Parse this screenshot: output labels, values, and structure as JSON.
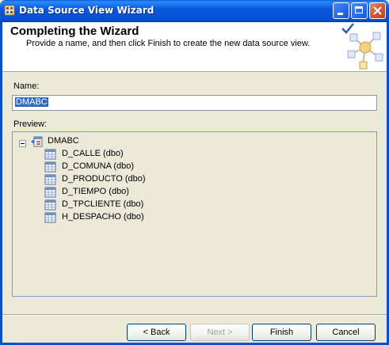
{
  "window": {
    "title": "Data Source View Wizard",
    "controls": [
      "minimize-icon",
      "maximize-icon",
      "close-icon"
    ]
  },
  "header": {
    "title": "Completing the Wizard",
    "subtitle": "Provide a name, and then click Finish to create the new data source view."
  },
  "form": {
    "name_label": "Name:",
    "name_value": "DMABC",
    "preview_label": "Preview:"
  },
  "tree": {
    "root": {
      "label": "DMABC",
      "icon": "data-source-view-icon",
      "expanded": true
    },
    "items": [
      {
        "label": "D_CALLE (dbo)",
        "icon": "table-icon"
      },
      {
        "label": "D_COMUNA (dbo)",
        "icon": "table-icon"
      },
      {
        "label": "D_PRODUCTO (dbo)",
        "icon": "table-icon"
      },
      {
        "label": "D_TIEMPO (dbo)",
        "icon": "table-icon"
      },
      {
        "label": "D_TPCLIENTE (dbo)",
        "icon": "table-icon"
      },
      {
        "label": "H_DESPACHO (dbo)",
        "icon": "table-icon"
      }
    ]
  },
  "buttons": {
    "back": "< Back",
    "next": "Next >",
    "next_enabled": false,
    "finish": "Finish",
    "cancel": "Cancel"
  },
  "colors": {
    "titlebar": "#0a58de",
    "dialog_bg": "#ece9d8",
    "selection": "#316ac5",
    "input_border": "#7f9db9"
  }
}
